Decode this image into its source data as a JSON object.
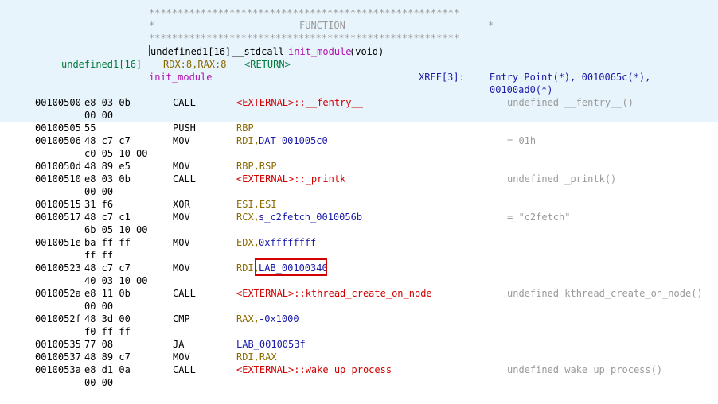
{
  "header": {
    "stars": "******************************************************",
    "star_left": "*",
    "function_label": "FUNCTION",
    "star_right": "*"
  },
  "signature": {
    "return_type": "undefined1[16]",
    "callconv": "__stdcall",
    "name": "init_module",
    "params": "(void)",
    "ret_type": "undefined1[16]",
    "ret_regs": "RDX:8,RAX:8",
    "ret_tag": "<RETURN>",
    "label": "init_module",
    "xref_label": "XREF[3]:",
    "xref_line1": "Entry Point(*), 0010065c(*),",
    "xref_line2": "00100ad0(*)"
  },
  "rows": [
    {
      "addr": "00100500",
      "bytes1": "e8 03 0b",
      "bytes2": "00 00",
      "mnem": "CALL",
      "op_a": "<EXTERNAL>::__fentry__",
      "op_b": "",
      "comment": "undefined __fentry__()"
    },
    {
      "addr": "00100505",
      "bytes1": "55",
      "bytes2": "",
      "mnem": "PUSH",
      "op_a": "RBP",
      "op_b": "",
      "comment": ""
    },
    {
      "addr": "00100506",
      "bytes1": "48 c7 c7",
      "bytes2": "c0 05 10 00",
      "mnem": "MOV",
      "op_a": "RDI,",
      "op_b": "DAT_001005c0",
      "comment": "= 01h"
    },
    {
      "addr": "0010050d",
      "bytes1": "48 89 e5",
      "bytes2": "",
      "mnem": "MOV",
      "op_a": "RBP,RSP",
      "op_b": "",
      "comment": ""
    },
    {
      "addr": "00100510",
      "bytes1": "e8 03 0b",
      "bytes2": "00 00",
      "mnem": "CALL",
      "op_a": "<EXTERNAL>::_printk",
      "op_b": "",
      "comment": "undefined _printk()"
    },
    {
      "addr": "00100515",
      "bytes1": "31 f6",
      "bytes2": "",
      "mnem": "XOR",
      "op_a": "ESI,ESI",
      "op_b": "",
      "comment": ""
    },
    {
      "addr": "00100517",
      "bytes1": "48 c7 c1",
      "bytes2": "6b 05 10 00",
      "mnem": "MOV",
      "op_a": "RCX,",
      "op_b": "s_c2fetch_0010056b",
      "comment": "= \"c2fetch\""
    },
    {
      "addr": "0010051e",
      "bytes1": "ba ff ff",
      "bytes2": "ff ff",
      "mnem": "MOV",
      "op_a": "EDX,",
      "op_b": "0xffffffff",
      "comment": ""
    },
    {
      "addr": "00100523",
      "bytes1": "48 c7 c7",
      "bytes2": "40 03 10 00",
      "mnem": "MOV",
      "op_a": "RDI,",
      "op_b": "LAB_00100340",
      "comment": ""
    },
    {
      "addr": "0010052a",
      "bytes1": "e8 11 0b",
      "bytes2": "00 00",
      "mnem": "CALL",
      "op_a": "<EXTERNAL>::kthread_create_on_node",
      "op_b": "",
      "comment": "undefined kthread_create_on_node()"
    },
    {
      "addr": "0010052f",
      "bytes1": "48 3d 00",
      "bytes2": "f0 ff ff",
      "mnem": "CMP",
      "op_a": "RAX,",
      "op_b": "-0x1000",
      "comment": ""
    },
    {
      "addr": "00100535",
      "bytes1": "77 08",
      "bytes2": "",
      "mnem": "JA",
      "op_a": "",
      "op_b": "LAB_0010053f",
      "comment": ""
    },
    {
      "addr": "00100537",
      "bytes1": "48 89 c7",
      "bytes2": "",
      "mnem": "MOV",
      "op_a": "RDI,RAX",
      "op_b": "",
      "comment": ""
    },
    {
      "addr": "0010053a",
      "bytes1": "e8 d1 0a",
      "bytes2": "00 00",
      "mnem": "CALL",
      "op_a": "<EXTERNAL>::wake_up_process",
      "op_b": "",
      "comment": "undefined wake_up_process()"
    }
  ],
  "colors": {
    "highlight_bg": "#e8f4fb",
    "selection_box": "#d40000",
    "mnemonic": "#000000",
    "register": "#8a6a00",
    "label": "#1a1aa8",
    "external": "#d20000",
    "function_name": "#b30fb3",
    "comment": "#9a9a9a"
  }
}
